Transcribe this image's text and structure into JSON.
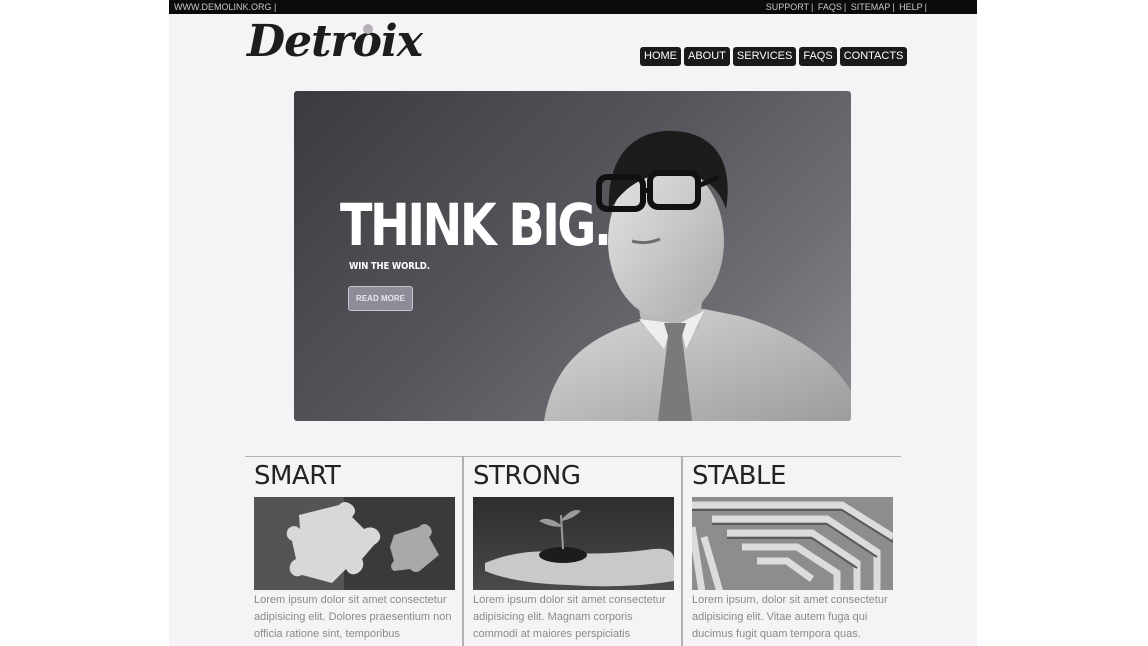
{
  "topbar": {
    "left_text": "WWW.DEMOLINK.ORG |",
    "links": [
      "SUPPORT",
      "FAQS",
      "SITEMAP",
      "HELP"
    ]
  },
  "logo": {
    "text": "Detroix"
  },
  "nav": {
    "items": [
      "HOME",
      "ABOUT",
      "SERVICES",
      "FAQS",
      "CONTACTS"
    ]
  },
  "hero": {
    "title": "THINK BIG.",
    "subtitle": "WIN THE WORLD.",
    "button_label": "READ MORE"
  },
  "features": [
    {
      "title": "SMART",
      "image": "puzzle-pieces-image",
      "text": "Lorem ipsum dolor sit amet consectetur adipisicing elit. Dolores praesentium non officia ratione sint, temporibus"
    },
    {
      "title": "STRONG",
      "image": "plant-in-hand-image",
      "text": "Lorem ipsum dolor sit amet consectetur adipisicing elit. Magnam corporis commodi at maiores perspiciatis"
    },
    {
      "title": "STABLE",
      "image": "maze-image",
      "text": "Lorem ipsum, dolor sit amet consectetur adipisicing elit. Vitae autem fuga qui ducimus fugit quam tempora quas."
    }
  ],
  "colors": {
    "page_bg": "#f6f3f6",
    "topbar_bg": "#0b0b0b",
    "nav_bg": "#1a1a1a",
    "text_gray": "#8a8a8a"
  }
}
